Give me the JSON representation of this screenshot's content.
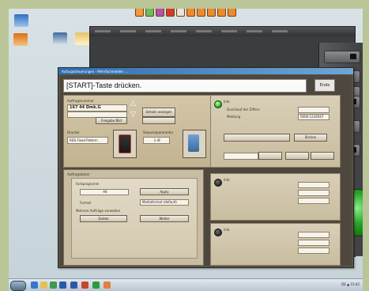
{
  "dialog": {
    "title": "Aufzugssteuerungen - Mehrfachmelder ...",
    "instruction": "[START]-Taste drücken.",
    "close_label": "Ende"
  },
  "left_panel": {
    "order_label": "Auftragsnummer",
    "order_value": "167 44 Dmk.G",
    "verify_label": "Freigabe Bild",
    "printer_label": "Drucker",
    "printer_value": "RDS Fixed Pattern",
    "prepare_label": "Druckvorgabe ...",
    "setup_value": "1-4F",
    "sequence_label": "Sequenzparameter",
    "btn_details": "Details anzeigen"
  },
  "sub_panel": {
    "title": "Auftragsdaten",
    "field1_label": "Farbprogramm",
    "field1_value": "Alt",
    "btn_apply": "Apply",
    "field2_label": "Format",
    "field2_value": "Mediaformat (default)",
    "field3_label": "Mehrere Aufträge verwalten",
    "btn_delete": "Delete",
    "btn_more": "Weiter"
  },
  "right_cols": [
    {
      "title": "Info",
      "row1_label": "Durchlauf der Ziffern",
      "row2_label": "Meldung",
      "row2_value": "0000-1234567",
      "btn": "Sticken",
      "led": "on"
    },
    {
      "title": "Info",
      "led": "off"
    },
    {
      "title": "Info",
      "led": "off"
    }
  ],
  "taskbar": {
    "tray_text": "DE  ▲  15:42"
  },
  "accent_colors": {
    "dialog_bg": "#4e473d",
    "panel": "#c8bda2",
    "led_on": "#2fc22f",
    "title_bar": "#2e6fb0"
  }
}
